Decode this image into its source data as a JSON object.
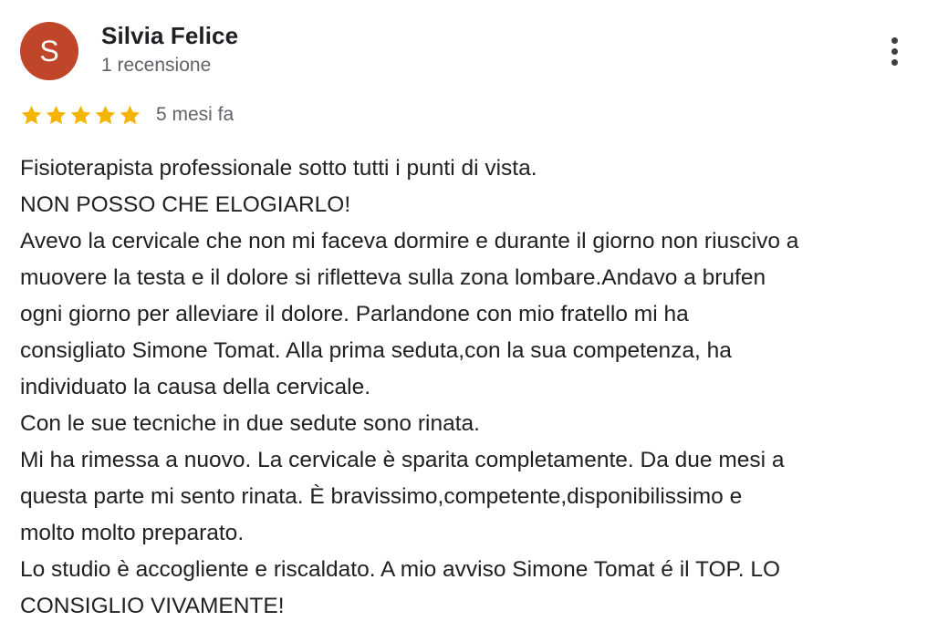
{
  "review": {
    "author": {
      "initial": "S",
      "name": "Silvia Felice",
      "reviews_count": "1 recensione"
    },
    "more_options_icon": "three-dots-vertical-icon",
    "rating": {
      "stars": 5,
      "max_stars": 5,
      "star_icon": "star-icon",
      "star_color": "#f5b400"
    },
    "date": "5 mesi fa",
    "text_lines": [
      "Fisioterapista professionale sotto tutti i punti di vista.",
      "NON POSSO CHE ELOGIARLO!",
      "Avevo la cervicale che non mi faceva dormire e durante il giorno non riuscivo a",
      "muovere la testa e il dolore si rifletteva sulla zona lombare.Andavo a brufen",
      "ogni giorno per alleviare il dolore. Parlandone con mio fratello mi ha",
      "consigliato Simone Tomat. Alla prima seduta,con la sua competenza, ha",
      "individuato la causa della cervicale.",
      "Con le sue tecniche in due sedute sono rinata.",
      "Mi ha rimessa a nuovo. La cervicale è sparita completamente. Da due mesi a",
      "questa parte mi sento rinata. È bravissimo,competente,disponibilissimo e",
      "molto molto preparato.",
      "Lo studio è accogliente e riscaldato. A mio avviso Simone Tomat é il TOP. LO",
      "CONSIGLIO VIVAMENTE!"
    ],
    "colors": {
      "avatar_bg": "#c0462a",
      "name": "#202124",
      "meta": "#5f6368",
      "text": "#202124"
    }
  }
}
